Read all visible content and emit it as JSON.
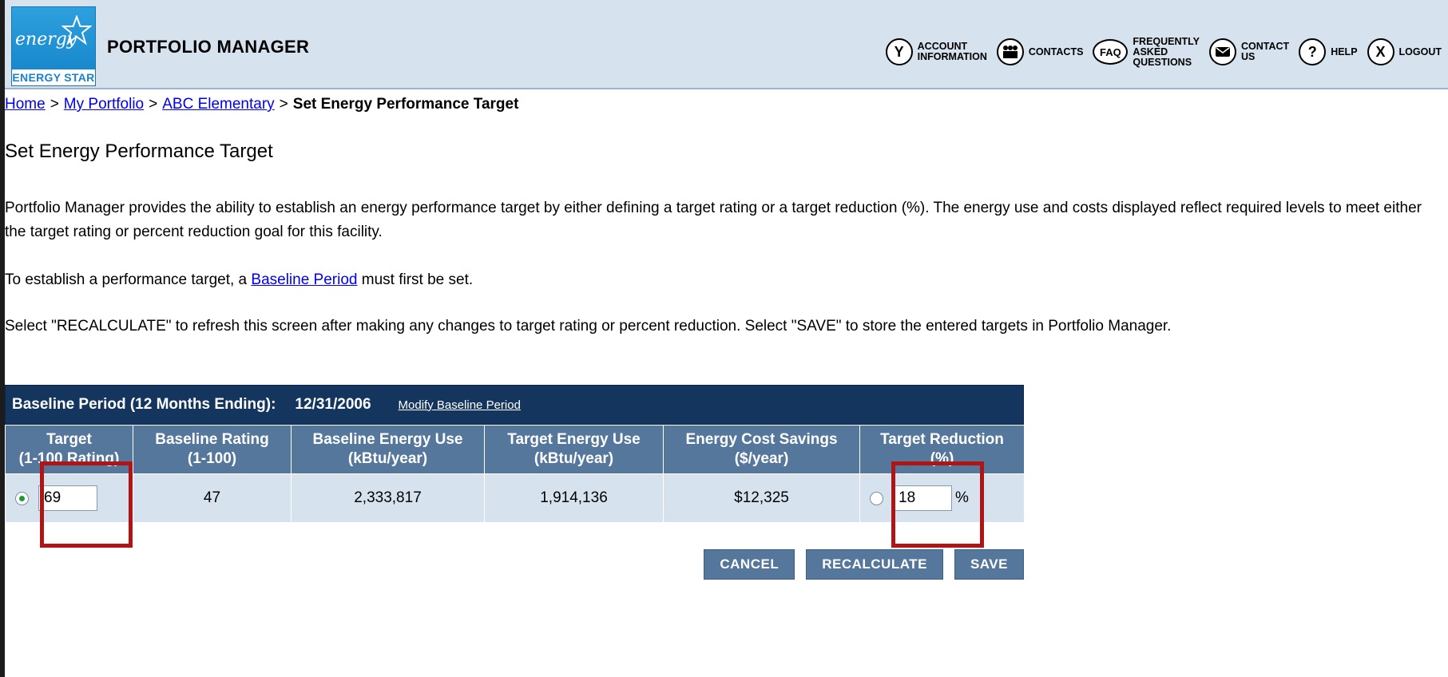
{
  "app": {
    "title": "PORTFOLIO MANAGER",
    "logo_script": "energy",
    "logo_text": "ENERGY STAR"
  },
  "nav": [
    {
      "icon": "account-icon",
      "glyph": "Y",
      "label": "ACCOUNT\nINFORMATION"
    },
    {
      "icon": "contacts-icon",
      "glyph": "👥",
      "label": "CONTACTS"
    },
    {
      "icon": "faq-icon",
      "glyph": "FAQ",
      "label": "FREQUENTLY\nASKED\nQUESTIONS"
    },
    {
      "icon": "contact-us-icon",
      "glyph": "✉",
      "label": "CONTACT\nUS"
    },
    {
      "icon": "help-icon",
      "glyph": "?",
      "label": "HELP"
    },
    {
      "icon": "logout-icon",
      "glyph": "X",
      "label": "LOGOUT"
    }
  ],
  "breadcrumb": {
    "home": "Home",
    "portfolio": "My Portfolio",
    "facility": "ABC Elementary",
    "separator": ">",
    "current": "Set Energy Performance Target"
  },
  "page_title": "Set Energy Performance Target",
  "paragraphs": {
    "p1": "Portfolio Manager provides the ability to establish an energy performance target by either defining a target rating or a target reduction (%). The energy use and costs displayed reflect required levels to meet either the target rating or percent reduction goal for this facility.",
    "p2_before": "To establish a performance target, a ",
    "p2_link": "Baseline Period",
    "p2_after": " must first be set.",
    "p3": "Select \"RECALCULATE\" to refresh this screen after making any changes to target rating or percent reduction. Select \"SAVE\" to store the entered targets in Portfolio Manager."
  },
  "baseline": {
    "label": "Baseline Period (12 Months Ending):",
    "date": "12/31/2006",
    "modify_link": "Modify Baseline Period"
  },
  "table": {
    "headers": [
      {
        "line1": "Target",
        "line2": "(1-100 Rating)"
      },
      {
        "line1": "Baseline Rating",
        "line2": "(1-100)"
      },
      {
        "line1": "Baseline Energy Use",
        "line2": "(kBtu/year)"
      },
      {
        "line1": "Target Energy Use",
        "line2": "(kBtu/year)"
      },
      {
        "line1": "Energy Cost Savings",
        "line2": "($/year)"
      },
      {
        "line1": "Target Reduction",
        "line2": "(%)"
      }
    ],
    "row": {
      "target_rating_selected": true,
      "target_rating": "69",
      "baseline_rating": "47",
      "baseline_energy_use": "2,333,817",
      "target_energy_use": "1,914,136",
      "energy_cost_savings": "$12,325",
      "target_reduction_selected": false,
      "target_reduction": "18",
      "pct_symbol": "%"
    }
  },
  "buttons": {
    "cancel": "CANCEL",
    "recalculate": "RECALCULATE",
    "save": "SAVE"
  },
  "colors": {
    "header_bg": "#d6e3ef",
    "table_header_dark": "#14365e",
    "table_header": "#55779c",
    "highlight": "#b01515"
  }
}
